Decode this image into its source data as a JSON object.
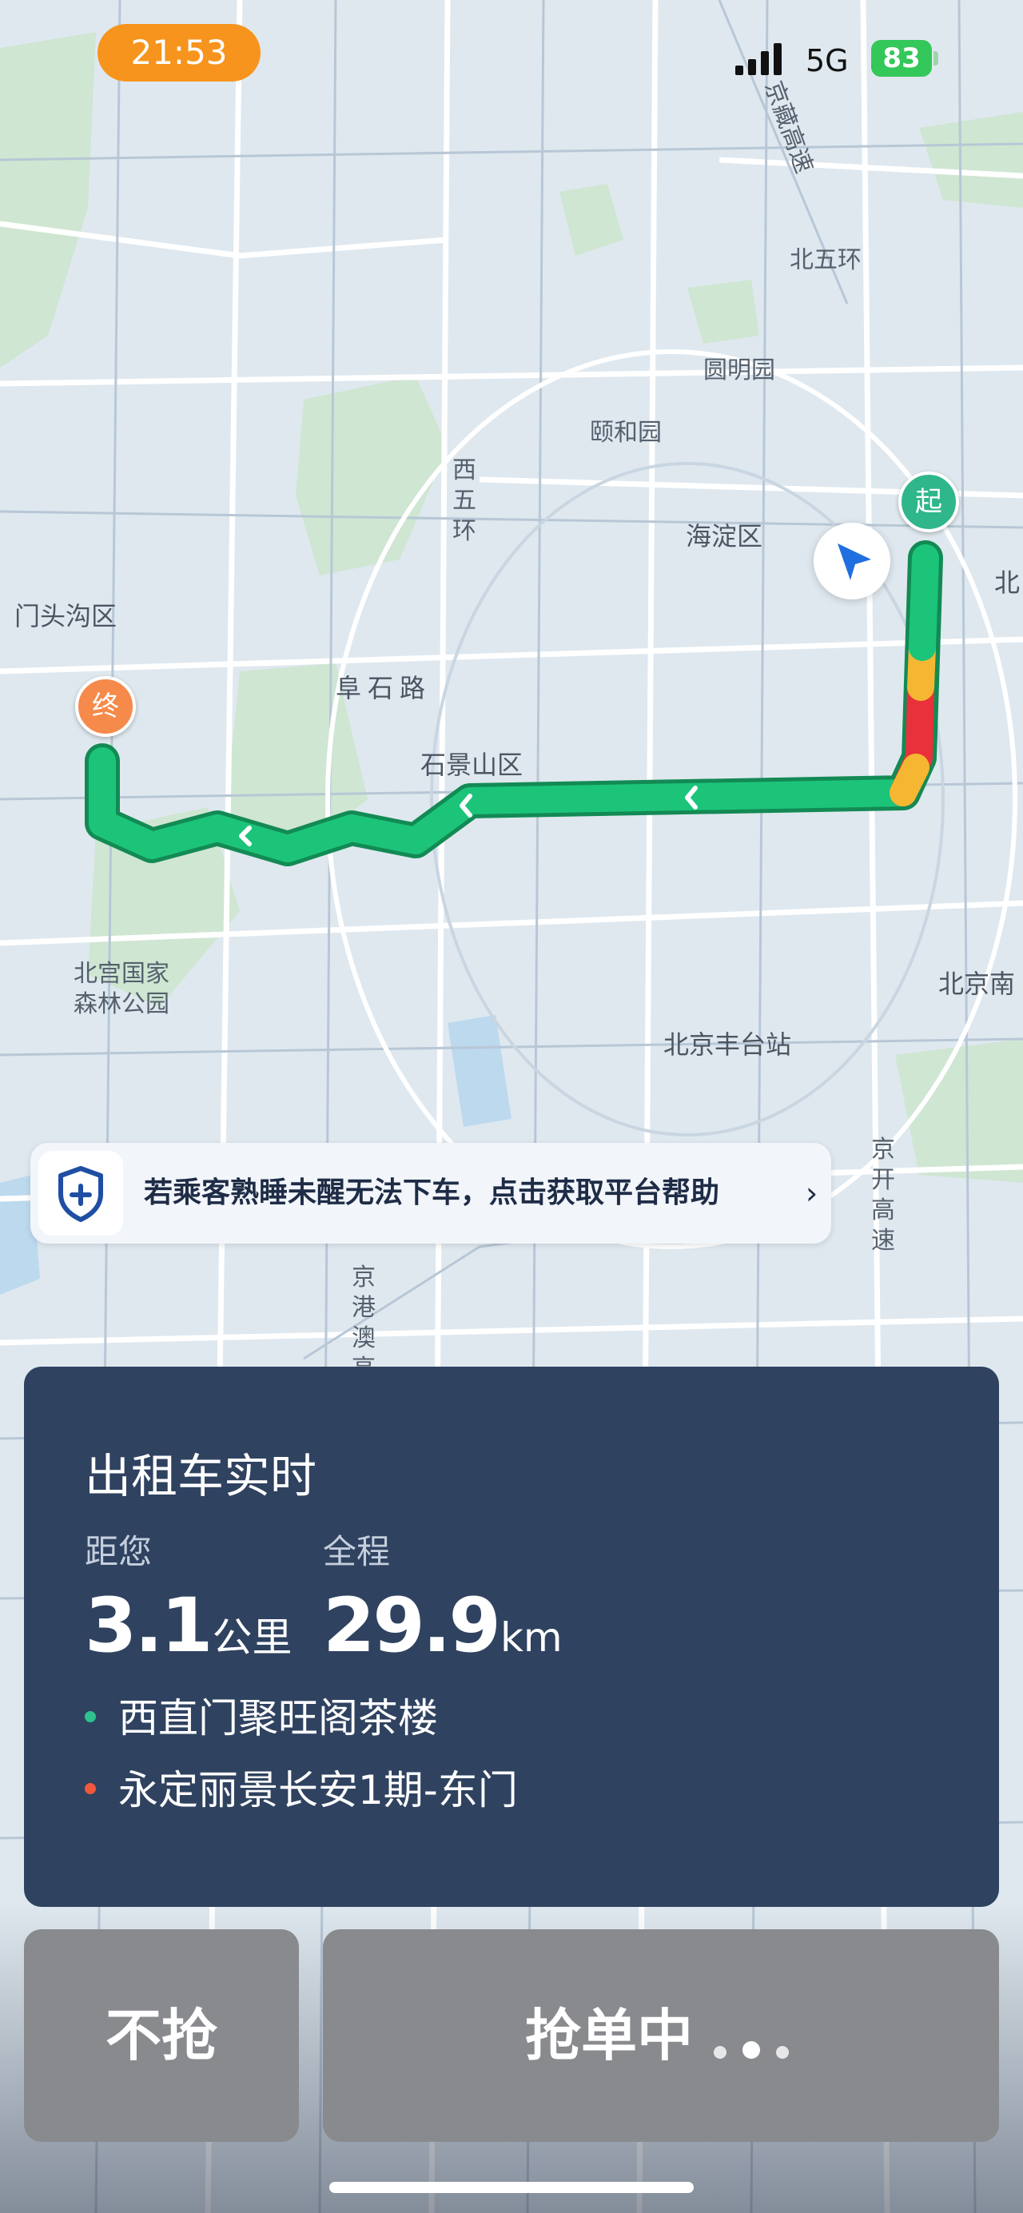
{
  "status_bar": {
    "time": "21:53",
    "network": "5G",
    "battery": "83"
  },
  "map": {
    "labels": {
      "beiwuhuan": "北五环",
      "jingzang": "京藏高速",
      "yuanmingyuan": "圆明园",
      "yiheyuan": "颐和园",
      "xiwuhuan": "西五环",
      "haidian": "海淀区",
      "bei_right": "北",
      "mentougou": "门头沟区",
      "fushilu": "阜石路",
      "shijingshan": "石景山区",
      "beigong": "北宫国家森林公园",
      "fengtai": "北京丰台站",
      "beijingnan": "北京南",
      "jingkai": "京开高速",
      "jinggang": "京港澳高速"
    },
    "start_pin": "起",
    "end_pin": "终",
    "colors": {
      "route_green": "#1cc47a",
      "route_red": "#e8313a",
      "route_yellow": "#f5b731",
      "route_outline": "#138a54"
    }
  },
  "banner": {
    "icon": "shield-plus-icon",
    "text": "若乘客熟睡未醒无法下车，点击获取平台帮助",
    "chevron": "›"
  },
  "card": {
    "title": "出租车实时",
    "distance_label": "距您",
    "distance_value": "3.1",
    "distance_unit": "公里",
    "total_label": "全程",
    "total_value": "29.9",
    "total_unit": "km",
    "pickup": "西直门聚旺阁茶楼",
    "dropoff": "永定丽景长安1期-东门",
    "pickup_color": "#2ec28e",
    "dropoff_color": "#f0583c"
  },
  "actions": {
    "skip_label": "不抢",
    "grab_label": "抢单中"
  }
}
